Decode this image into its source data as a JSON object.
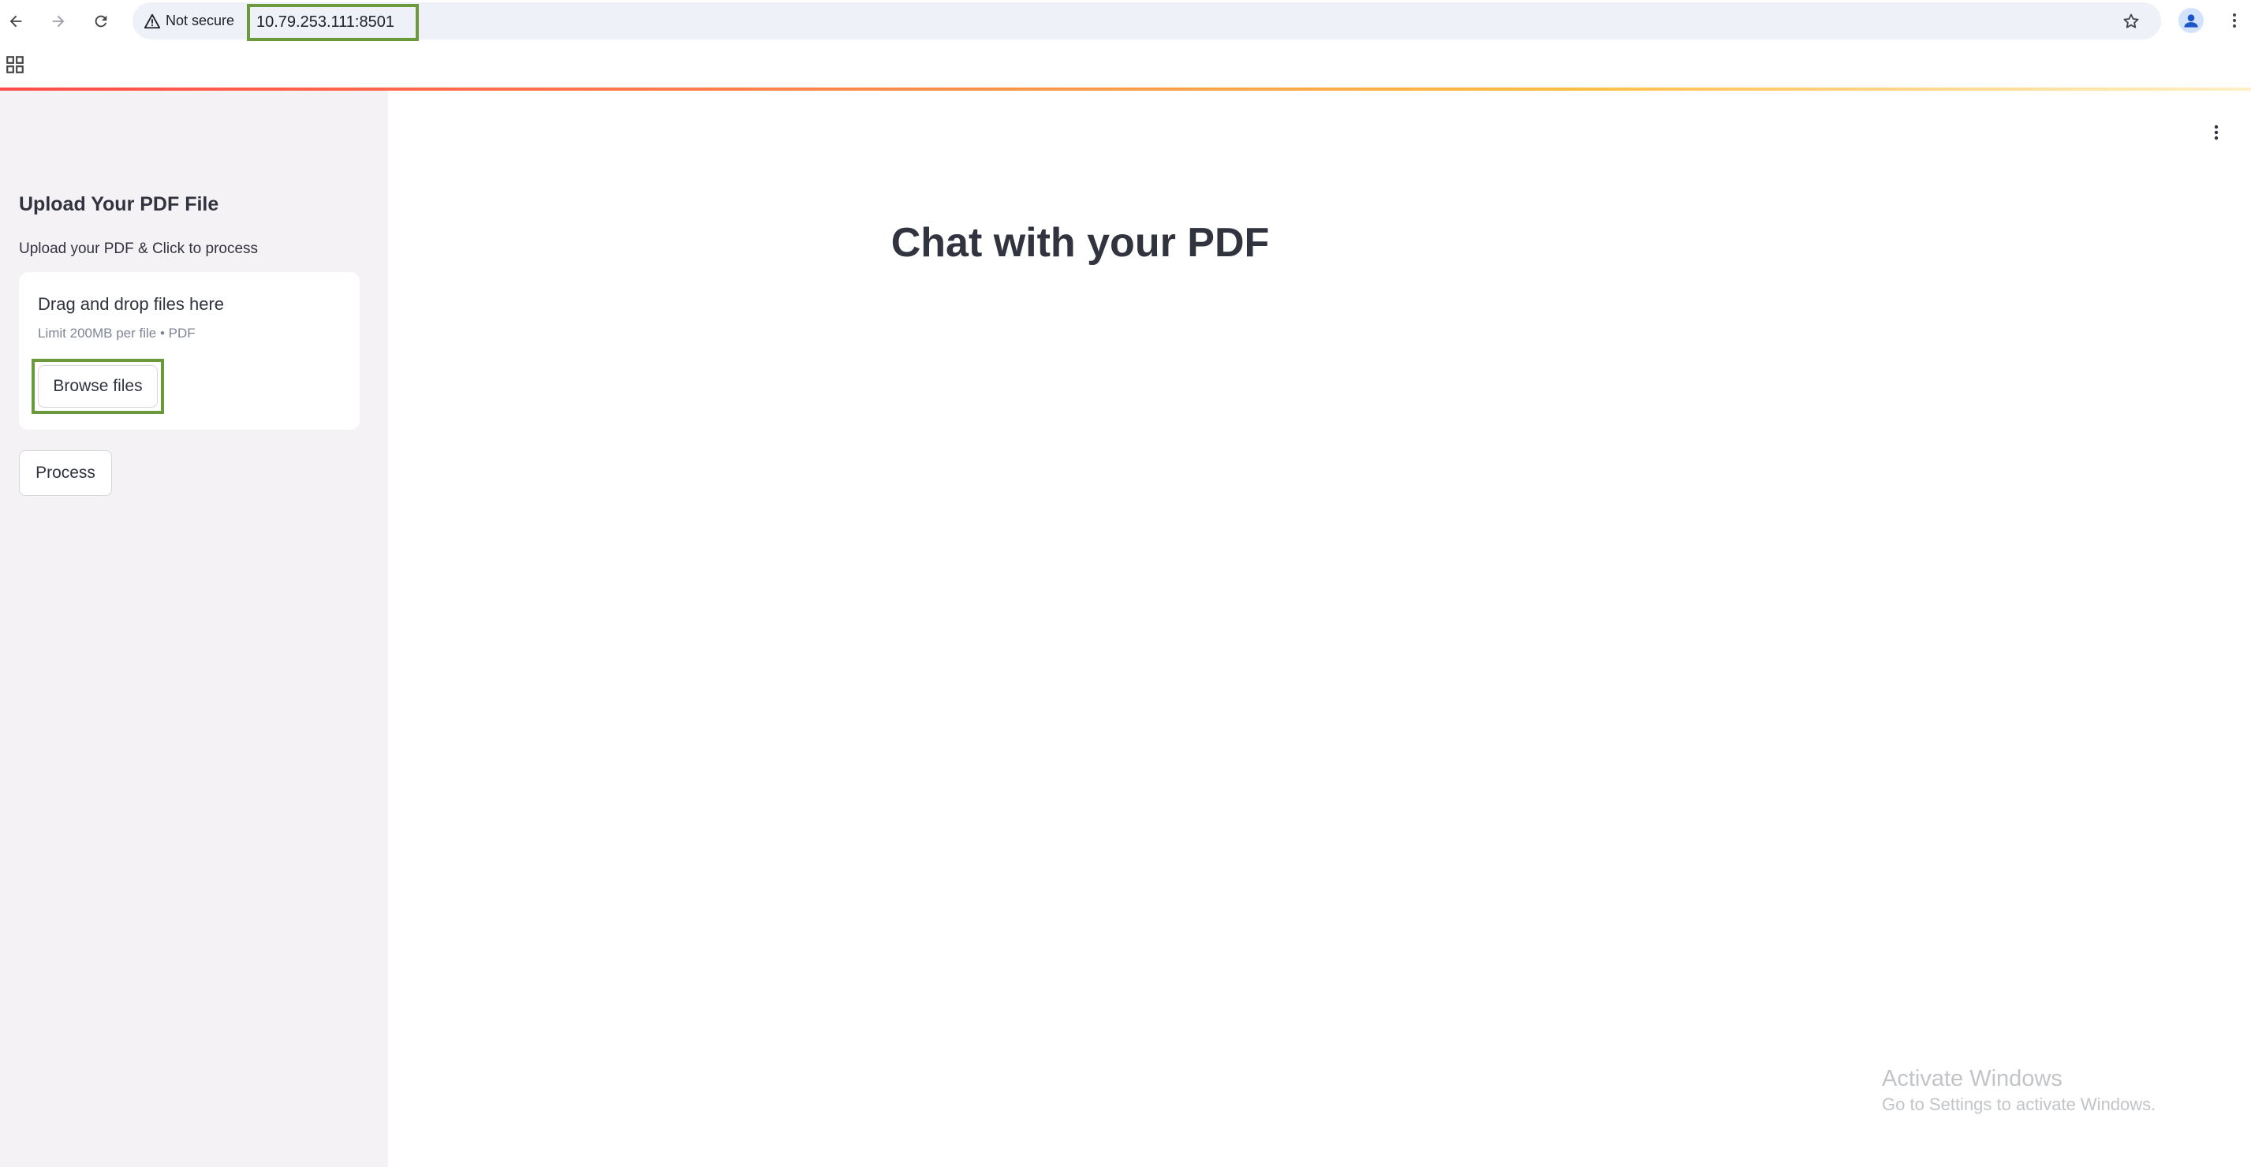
{
  "browser": {
    "security_label": "Not secure",
    "url": "10.79.253.111:8501"
  },
  "sidebar": {
    "title": "Upload Your PDF File",
    "upload_label": "Upload your PDF & Click to process",
    "dropzone": {
      "title": "Drag and drop files here",
      "limit": "Limit 200MB per file • PDF",
      "browse_label": "Browse files"
    },
    "process_label": "Process"
  },
  "main": {
    "title": "Chat with your PDF"
  },
  "watermark": {
    "title": "Activate Windows",
    "subtitle": "Go to Settings to activate Windows."
  },
  "colors": {
    "highlight_border": "#6a9a3b",
    "sidebar_bg": "#f5f2f6",
    "header_gradient_start": "#ff4b4b",
    "header_gradient_end": "#ffbd45",
    "text_primary": "#31333f"
  },
  "icons": {
    "back": "arrow-left-icon",
    "forward": "arrow-right-icon",
    "reload": "reload-icon",
    "warning": "warning-triangle-icon",
    "bookmark": "star-icon",
    "profile": "person-icon",
    "browser_menu": "vertical-dots-icon",
    "apps": "apps-grid-icon",
    "app_menu": "vertical-dots-icon"
  }
}
